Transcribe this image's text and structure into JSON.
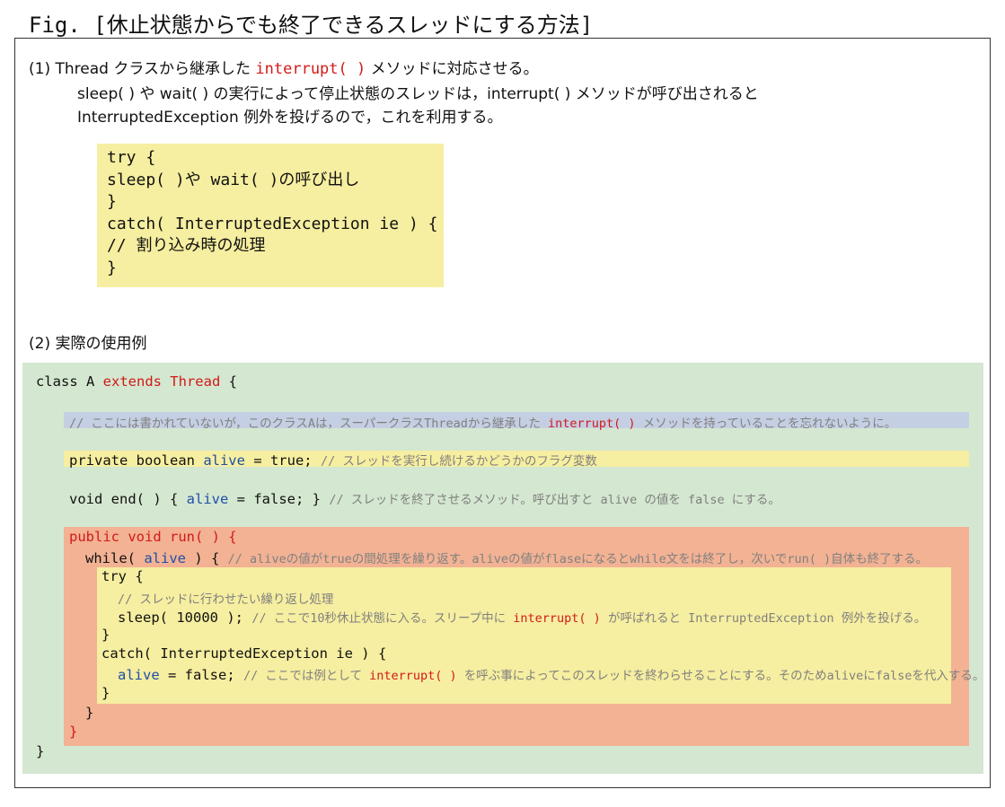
{
  "title": "Fig. [休止状態からでも終了できるスレッドにする方法]",
  "section1": {
    "heading_prefix": "(1) Thread クラスから継承した",
    "heading_method": "interrupt( )",
    "heading_suffix": "メソッドに対応させる。",
    "desc_line1": "sleep( ) や wait( ) の実行によって停止状態のスレッドは，interrupt( ) メソッドが呼び出されると",
    "desc_line2": "InterruptedException 例外を投げるので，これを利用する。",
    "code": [
      "try {",
      "  sleep( )や wait( )の呼び出し",
      "}",
      "catch( InterruptedException ie ) {",
      "  // 割り込み時の処理",
      "}"
    ]
  },
  "section2": {
    "heading": "(2) 実際の使用例",
    "class_decl": {
      "a": "class A ",
      "b": "extends Thread",
      "c": " {"
    },
    "comment_note": {
      "a": "// ここには書かれていないが，このクラスAは，スーパークラスThreadから継承した ",
      "b": "interrupt( )",
      "c": " メソッドを持っていることを忘れないように。"
    },
    "field_line": {
      "a": "private boolean ",
      "b": "alive",
      "c": " = true; ",
      "d": "// スレッドを実行し続けるかどうかのフラグ変数"
    },
    "end_line": {
      "a": "void end( ) { ",
      "b": "alive",
      "c": " = false; } ",
      "d": "// スレッドを終了させるメソッド。呼び出すと alive の値を false にする。"
    },
    "run_open": "public void run( ) {",
    "while_line": {
      "a": "while( ",
      "b": "alive",
      "c": " ) { ",
      "d": "// aliveの値がtrueの間処理を繰り返す。aliveの値がflaseになるとwhile文をは終了し，次いでrun( )自体も終了する。"
    },
    "try_open": "try {",
    "try_comment": "// スレッドに行わせたい繰り返し処理",
    "sleep_line": {
      "a": "sleep( 10000 ); ",
      "b": "// ここで10秒休止状態に入る。スリープ中に ",
      "c": "interrupt( )",
      "d": " が呼ばれると InterruptedException 例外を投げる。"
    },
    "try_close": "}",
    "catch_open": "catch( InterruptedException ie ) {",
    "catch_line": {
      "a": "alive",
      "b": " = false; ",
      "c": "// ここでは例として ",
      "d": "interrupt( )",
      "e": " を呼ぶ事によってこのスレッドを終わらせることにする。そのためaliveにfalseを代入する。"
    },
    "catch_close": "}",
    "while_close": "}",
    "run_close": "}",
    "class_close": "}"
  },
  "colors": {
    "keyword_red": "#d11a1a",
    "identifier_blue": "#1f4fa8",
    "comment_gray": "#808080",
    "yellow_bg": "#f6eea0",
    "green_bg": "#d4e7d0",
    "blue_bg": "#c5cfe3",
    "orange_bg": "#f2b293"
  }
}
